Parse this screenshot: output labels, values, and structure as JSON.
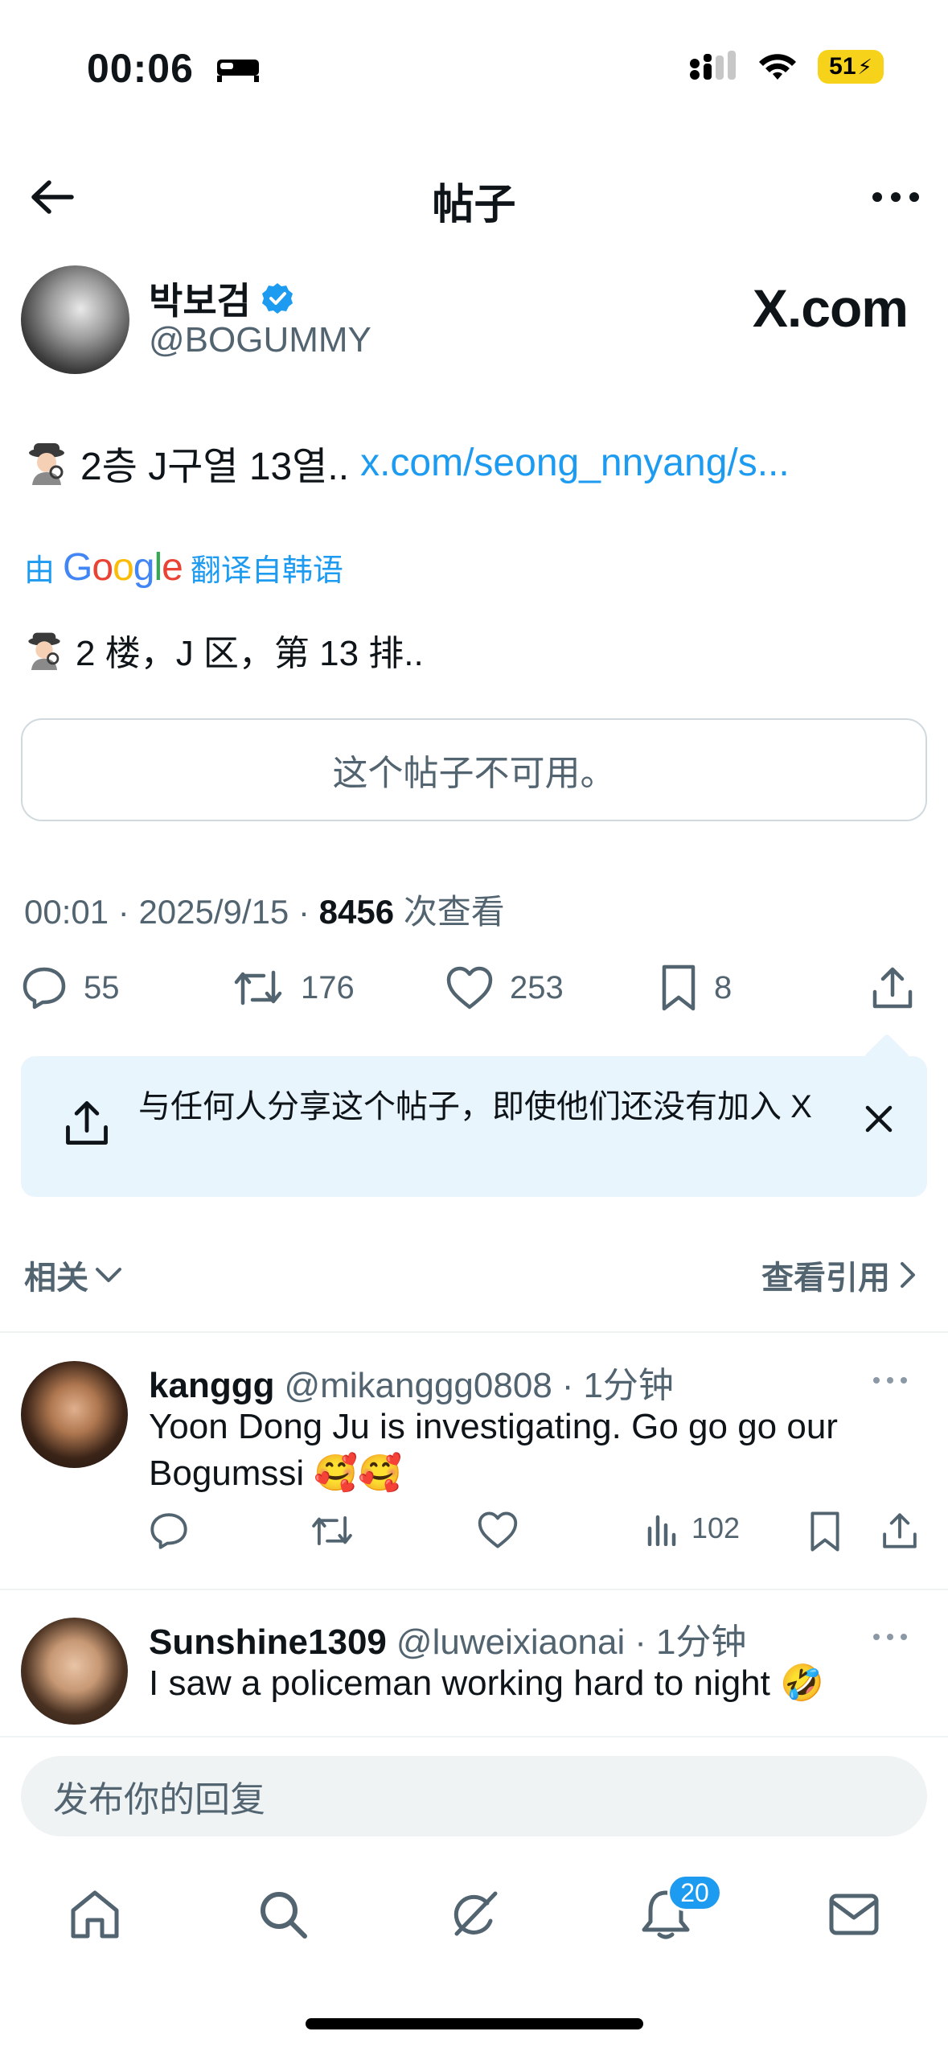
{
  "status_bar": {
    "time": "00:06",
    "battery": "51"
  },
  "header": {
    "title": "帖子"
  },
  "post": {
    "author_name": "박보검",
    "author_handle": "@BOGUMMY",
    "watermark": "X.com",
    "text": "2층 J구열 13열..",
    "link": "x.com/seong_nnyang/s...",
    "translated_by_prefix": "由",
    "translated_by_brand": "Google",
    "translated_by_suffix": "翻译自韩语",
    "translation": "2 楼，J 区，第 13 排..",
    "unavailable_notice": "这个帖子不可用。",
    "time": "00:01",
    "date": "2025/9/15",
    "views": "8456",
    "views_label": "次查看",
    "replies": "55",
    "reposts": "176",
    "likes": "253",
    "bookmarks": "8"
  },
  "share_banner": {
    "text": "与任何人分享这个帖子，即使他们还没有加入 X"
  },
  "section": {
    "related_label": "相关",
    "quotes_label": "查看引用"
  },
  "replies": [
    {
      "name": "kanggg",
      "handle": "@mikanggg0808",
      "time": "1分钟",
      "text": "Yoon Dong Ju is investigating. Go go go our Bogumssi 🥰🥰",
      "views": "102"
    },
    {
      "name": "Sunshine1309",
      "handle": "@luweixiaonai",
      "time": "1分钟",
      "text": "I saw a policeman working hard to night 🤣"
    }
  ],
  "reply_box": {
    "placeholder": "发布你的回复"
  },
  "tabbar": {
    "notification_count": "20"
  },
  "colors": {
    "accent": "#1d9bf0",
    "secondary_text": "#536471",
    "share_banner_bg": "#e8f5fd"
  },
  "icons": [
    "back-arrow-icon",
    "more-icon",
    "verified-icon",
    "detective-emoji-icon",
    "reply-icon",
    "repost-icon",
    "like-icon",
    "bookmark-icon",
    "share-icon",
    "close-icon",
    "chevron-down-icon",
    "chevron-right-icon",
    "views-icon",
    "home-icon",
    "search-icon",
    "grok-icon",
    "bell-icon",
    "mail-icon"
  ]
}
